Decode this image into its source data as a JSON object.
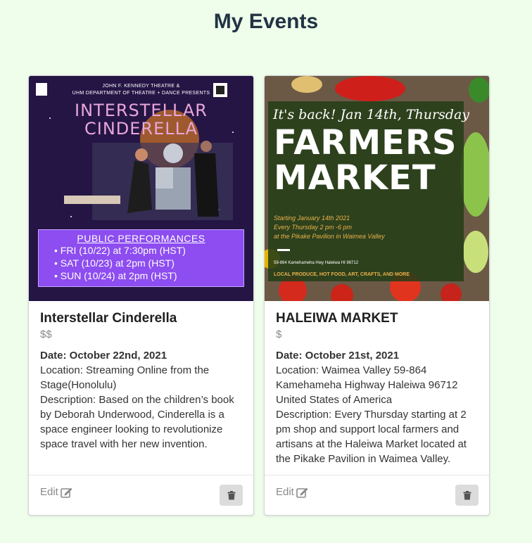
{
  "page": {
    "title": "My Events"
  },
  "events": [
    {
      "name": "Interstellar Cinderella",
      "price": "$$",
      "date": "Date: October 22nd, 2021",
      "location": "Location: Streaming Online from the Stage(Honolulu)",
      "description": "Description: Based on the children’s book by Deborah Underwood, Cinderella is a space engineer looking to revolutionize space travel with her new invention.",
      "edit_label": "Edit",
      "poster": {
        "header_line1": "JOHN F. KENNEDY THEATRE &",
        "header_line2": "UHM DEPARTMENT OF THEATRE + DANCE PRESENTS",
        "title_line1": "INTERSTELLAR",
        "title_line2": "CINDERELLA",
        "box_heading": "PUBLIC PERFORMANCES",
        "performances": [
          "• FRI (10/22) at 7:30pm (HST)",
          "• SAT (10/23) at 2pm (HST)",
          "• SUN (10/24) at 2pm (HST)"
        ]
      }
    },
    {
      "name": "HALEIWA MARKET",
      "price": "$",
      "date": "Date: October 21st, 2021",
      "location": "Location: Waimea Valley 59-864 Kamehameha Highway Haleiwa 96712 United States of America",
      "description": "Description: Every Thursday starting at 2 pm shop and support local farmers and artisans at the Haleiwa Market located at the Pikake Pavilion in Waimea Valley.",
      "edit_label": "Edit",
      "poster": {
        "tagline": "It's back! Jan 14th, Thursday",
        "title_line1": "FARMERS",
        "title_line2": "MARKET",
        "info_line1": "Starting January 14th 2021",
        "info_line2": "Every Thursday 2 pm -6 pm",
        "info_line3": "at the Pikake Pavilion in Waimea Valley",
        "address": "59-864 Kamehameha Hwy Haleiwa HI 96712",
        "footer": "LOCAL PRODUCE, HOT FOOD, ART, CRAFTS, AND MORE"
      }
    }
  ],
  "colors": {
    "background": "#effdeb",
    "title": "#223344",
    "muted": "#8a8a8a",
    "delete_button": "#dcdcdc"
  },
  "icons": {
    "edit": "edit-pencil-square-icon",
    "delete": "trash-icon"
  }
}
